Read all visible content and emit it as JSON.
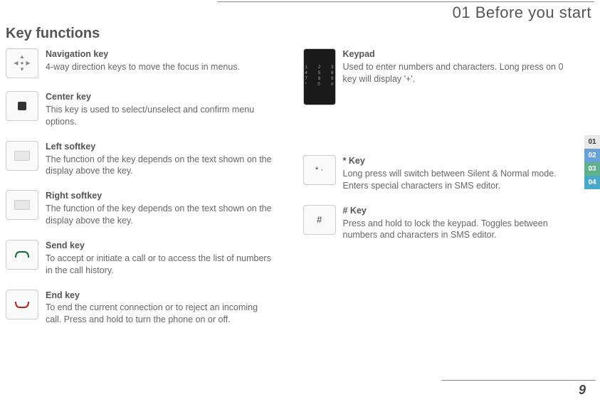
{
  "chapter_title": "01 Before you start",
  "section_title": "Key functions",
  "page_number": "9",
  "side_tabs": [
    "01",
    "02",
    "03",
    "04"
  ],
  "left_items": [
    {
      "title": "Navigation key",
      "desc": "4-way direction keys to move the focus in menus."
    },
    {
      "title": "Center key",
      "desc": "This key is used to select/unselect and confirm menu options."
    },
    {
      "title": "Left  softkey",
      "desc": "The function of the key depends on the text shown on the display above the key."
    },
    {
      "title": "Right  softkey",
      "desc": "The function of the key depends on the text shown on the display above the key."
    },
    {
      "title": "Send key",
      "desc": "To accept or initiate a call or to access the list of numbers in the call history."
    },
    {
      "title": "End key",
      "desc": "To end the current connection or to reject an incoming call. Press and hold to turn the phone on or off."
    }
  ],
  "right_items": [
    {
      "title": "Keypad",
      "desc": "Used to enter numbers and characters. Long press on 0 key will display '+'."
    },
    {
      "title": "* Key",
      "desc": "Long press will switch between Silent & Normal mode. Enters special characters in SMS editor."
    },
    {
      "title": "# Key",
      "desc": "Press and hold to lock the keypad. Toggles between numbers and characters in SMS editor."
    }
  ]
}
